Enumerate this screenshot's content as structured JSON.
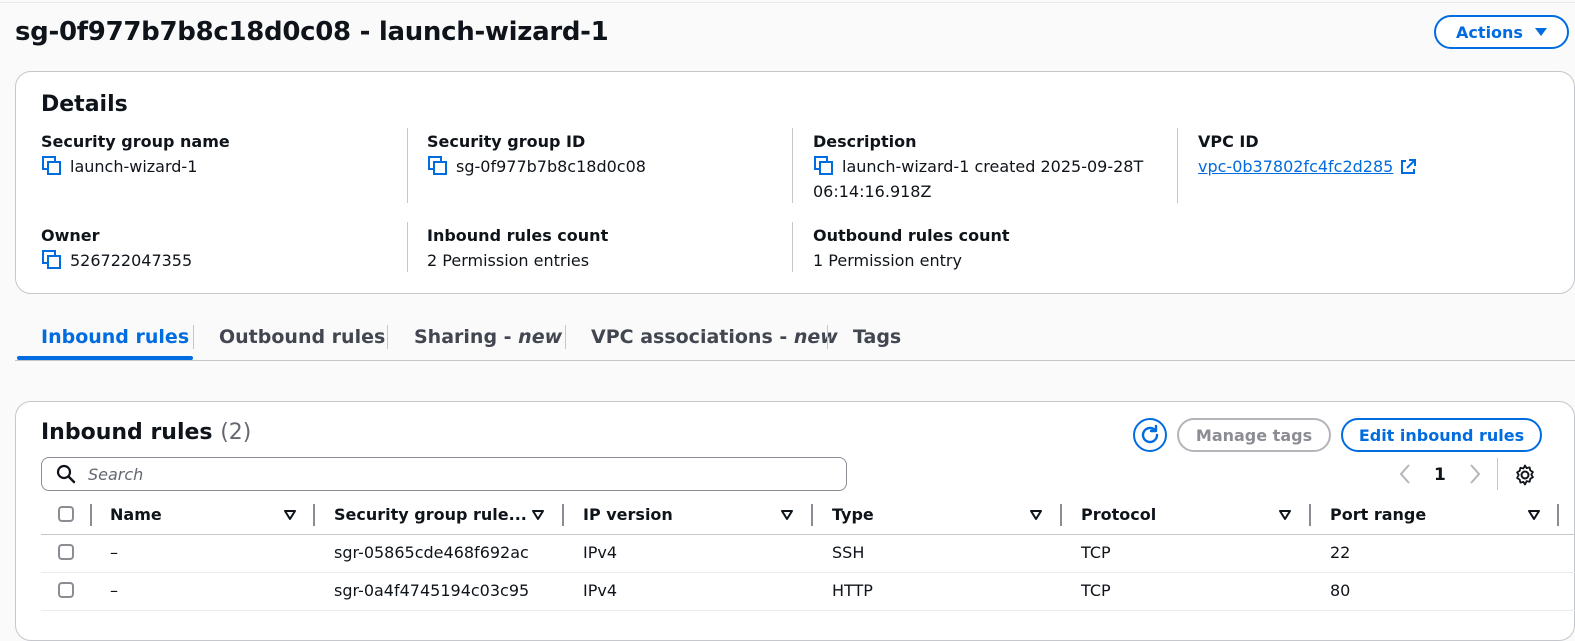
{
  "page": {
    "title": "sg-0f977b7b8c18d0c08 - launch-wizard-1",
    "actions_label": "Actions"
  },
  "details": {
    "title": "Details",
    "security_group_name": {
      "label": "Security group name",
      "value": "launch-wizard-1"
    },
    "security_group_id": {
      "label": "Security group ID",
      "value": "sg-0f977b7b8c18d0c08"
    },
    "description": {
      "label": "Description",
      "value": "launch-wizard-1 created 2025-09-28T 06:14:16.918Z"
    },
    "vpc_id": {
      "label": "VPC ID",
      "value": "vpc-0b37802fc4fc2d285"
    },
    "owner": {
      "label": "Owner",
      "value": "526722047355"
    },
    "inbound_count": {
      "label": "Inbound rules count",
      "value": "2 Permission entries"
    },
    "outbound_count": {
      "label": "Outbound rules count",
      "value": "1 Permission entry"
    }
  },
  "tabs": [
    {
      "label": "Inbound rules",
      "suffix": ""
    },
    {
      "label": "Outbound rules",
      "suffix": ""
    },
    {
      "label": "Sharing - ",
      "suffix": "new"
    },
    {
      "label": "VPC associations - ",
      "suffix": "new"
    },
    {
      "label": "Tags",
      "suffix": ""
    }
  ],
  "inbound": {
    "title": "Inbound rules",
    "count": "(2)",
    "manage_tags_label": "Manage tags",
    "edit_label": "Edit inbound rules",
    "search_placeholder": "Search",
    "page_number": "1",
    "columns": [
      "Name",
      "Security group rule...",
      "IP version",
      "Type",
      "Protocol",
      "Port range"
    ],
    "rows": [
      {
        "name": "–",
        "rule_id": "sgr-05865cde468f692ac",
        "ip_version": "IPv4",
        "type": "SSH",
        "protocol": "TCP",
        "port_range": "22"
      },
      {
        "name": "–",
        "rule_id": "sgr-0a4f4745194c03c95",
        "ip_version": "IPv4",
        "type": "HTTP",
        "protocol": "TCP",
        "port_range": "80"
      }
    ]
  },
  "colors": {
    "accent": "#006ce0",
    "border": "#c6c6cd",
    "disabled": "#8c8c94"
  }
}
